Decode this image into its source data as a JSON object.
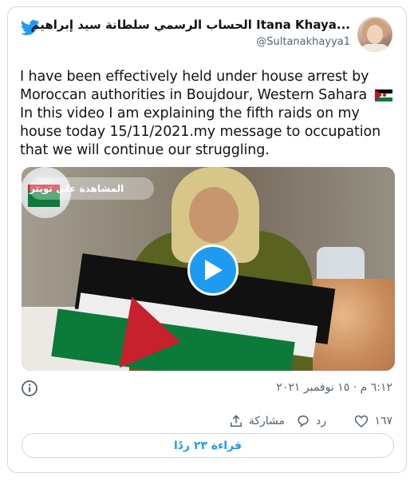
{
  "tweet": {
    "display_name": "...Itana Khaya الحساب الرسمي سلطانة سيد إبراهيم خيا",
    "handle": "@Sultanakhayya1",
    "text": "I have been effectively held under house arrest by Moroccan authorities in Boujdour,  Western Sahara",
    "text_continued": "In this video  I am explaining the fifth raids on my house today 15/11/2021.my message to occupation that we will continue our struggling.",
    "media": {
      "views_label": "المشاهدة على تويتر",
      "play_icon": "play-icon"
    },
    "timestamp": "٦:١٢ م · ١٥ نوفمبر ٢٠٢١",
    "actions": {
      "like_count": "١٦٧",
      "reply_label": "رد",
      "share_label": "مشاركة"
    },
    "read_replies_label": "قراءة ٢٣ ردًا"
  },
  "colors": {
    "twitter_blue": "#1d9bf0",
    "secondary_text": "#536471",
    "border": "#cfd9de"
  }
}
